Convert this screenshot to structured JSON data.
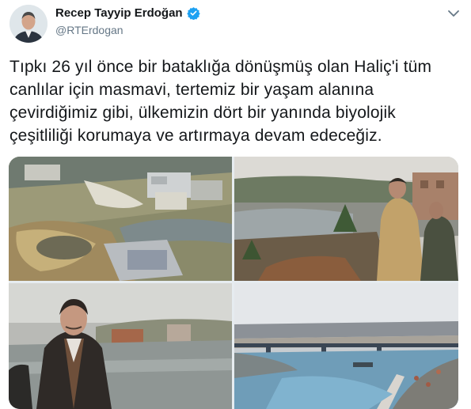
{
  "tweet": {
    "author_name": "Recep Tayyip Erdoğan",
    "author_handle": "@RTErdogan",
    "text": "Tıpkı 26 yıl önce bir bataklığa dönüşmüş olan Haliç'i tüm canlılar için masmavi, tertemiz bir yaşam alanına çevirdiğimiz gibi, ülkemizin dört bir yanında biyolojik çeşitliliği korumaya ve artırmaya devam edeceğiz.",
    "icons": {
      "verified": "verified-badge-icon",
      "menu": "chevron-down-icon"
    },
    "colors": {
      "verified": "#1da1f2",
      "handle": "#657786",
      "text": "#14171a"
    },
    "media": [
      {
        "name": "aerial-construction-site-photo"
      },
      {
        "name": "officials-overlooking-marsh-photo"
      },
      {
        "name": "man-by-water-photo"
      },
      {
        "name": "golden-horn-bridge-photo"
      }
    ]
  }
}
